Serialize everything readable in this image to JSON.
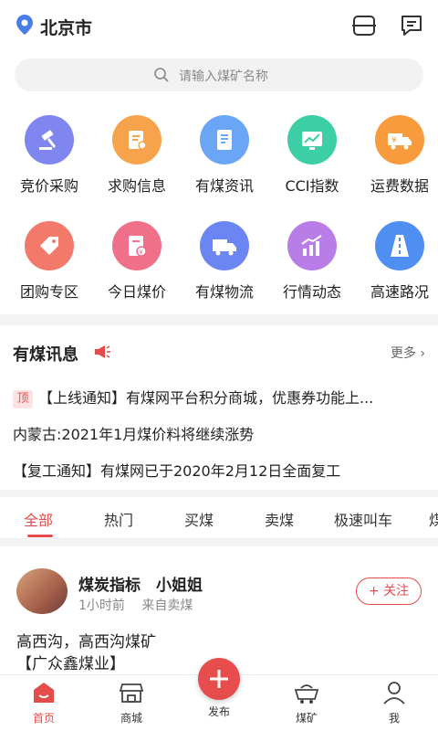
{
  "header": {
    "city": "北京市",
    "location_icon": "location-pin-icon",
    "scan_icon": "scan-icon",
    "message_icon": "message-icon"
  },
  "search": {
    "placeholder": "请输入煤矿名称"
  },
  "grid": {
    "items": [
      {
        "label": "竞价采购",
        "icon": "auction-gavel-icon",
        "color": "#7f86f0"
      },
      {
        "label": "求购信息",
        "icon": "clipboard-search-icon",
        "color": "#f7a34b"
      },
      {
        "label": "有煤资讯",
        "icon": "document-icon",
        "color": "#6aa6f5"
      },
      {
        "label": "CCI指数",
        "icon": "chart-screen-icon",
        "color": "#3ccfa6"
      },
      {
        "label": "运费数据",
        "icon": "truck-yen-icon",
        "color": "#f79b3d"
      },
      {
        "label": "团购专区",
        "icon": "tag-icon",
        "color": "#f37a6b"
      },
      {
        "label": "今日煤价",
        "icon": "price-document-icon",
        "color": "#f0708a"
      },
      {
        "label": "有煤物流",
        "icon": "truck-icon",
        "color": "#6b86f2"
      },
      {
        "label": "行情动态",
        "icon": "trend-bars-icon",
        "color": "#b97de8"
      },
      {
        "label": "高速路况",
        "icon": "road-icon",
        "color": "#4f8ff2"
      }
    ]
  },
  "news": {
    "title": "有煤讯息",
    "more": "更多",
    "pin_label": "顶",
    "items": [
      "【上线通知】有煤网平台积分商城，优惠券功能上...",
      "内蒙古:2021年1月煤价料将继续涨势",
      "【复工通知】有煤网已于2020年2月12日全面复工"
    ]
  },
  "tabs": [
    "全部",
    "热门",
    "买煤",
    "卖煤",
    "极速叫车",
    "煤"
  ],
  "post": {
    "author": "煤炭指标　小姐姐",
    "time": "1小时前",
    "source": "来自卖煤",
    "follow": "+ 关注",
    "text": "高西沟，高西沟煤矿",
    "text2": "【广众鑫煤业】"
  },
  "bottom_nav": {
    "items": [
      {
        "label": "首页",
        "icon": "home-icon"
      },
      {
        "label": "商城",
        "icon": "shop-icon"
      },
      {
        "label": "发布",
        "icon": "plus-icon"
      },
      {
        "label": "煤矿",
        "icon": "coal-cart-icon"
      },
      {
        "label": "我",
        "icon": "user-icon"
      }
    ]
  },
  "colors": {
    "accent": "#e44c4c"
  }
}
